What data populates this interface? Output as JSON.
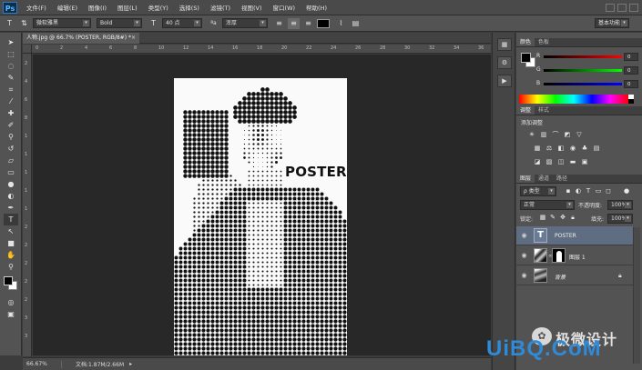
{
  "app": {
    "logo": "Ps",
    "menu": [
      "文件(F)",
      "编辑(E)",
      "图像(I)",
      "图层(L)",
      "类型(Y)",
      "选择(S)",
      "滤镜(T)",
      "视图(V)",
      "窗口(W)",
      "帮助(H)"
    ]
  },
  "options": {
    "tool_glyph": "T",
    "font_family": "微软雅黑",
    "font_style": "Bold",
    "font_size": "40 点",
    "aa_label": "ªa",
    "aa_mode": "浑厚",
    "workspace": "基本功能",
    "text_color": "#000000"
  },
  "document": {
    "tab_title": "人物.jpg @ 66.7% (POSTER, RGB/8#) *",
    "close_glyph": "×",
    "ruler_ticks_top": [
      "0",
      "2",
      "4",
      "6",
      "8",
      "10",
      "12",
      "14",
      "16",
      "18",
      "20",
      "22",
      "24",
      "26",
      "28",
      "30",
      "32",
      "34",
      "36"
    ],
    "ruler_ticks_left": [
      "2",
      "4",
      "6",
      "8",
      "1",
      "1",
      "1",
      "1",
      "1",
      "2",
      "2",
      "2",
      "2",
      "2",
      "3",
      "3"
    ],
    "poster_text": "POSTER"
  },
  "status": {
    "zoom": "66.67%",
    "doc_size": "文档:1.87M/2.66M"
  },
  "color_panel": {
    "tabs": [
      "颜色",
      "色板"
    ],
    "channels": [
      {
        "label": "R",
        "value": "0",
        "track_from": "#000000",
        "track_to": "#ff0000"
      },
      {
        "label": "G",
        "value": "0",
        "track_from": "#000000",
        "track_to": "#00ff00"
      },
      {
        "label": "B",
        "value": "0",
        "track_from": "#000000",
        "track_to": "#0000ff"
      }
    ]
  },
  "adjust_panel": {
    "tabs": [
      "调整",
      "样式"
    ],
    "heading": "添加调整"
  },
  "layers_panel": {
    "tabs": [
      "图层",
      "通道",
      "路径"
    ],
    "filter_label": "ρ 类型",
    "blend_mode": "正常",
    "opacity_label": "不透明度:",
    "opacity_value": "100%",
    "lock_label": "锁定:",
    "fill_label": "填充:",
    "fill_value": "100%",
    "layers": [
      {
        "name": "POSTER",
        "kind": "text",
        "thumb_glyph": "T",
        "selected": true
      },
      {
        "name": "图层 1",
        "kind": "masked",
        "thumb_glyph": "",
        "selected": false
      },
      {
        "name": "背景",
        "kind": "image",
        "thumb_glyph": "",
        "selected": false
      }
    ]
  },
  "watermark": {
    "cn": "极微设计",
    "en": "UiBQ.CoM"
  }
}
